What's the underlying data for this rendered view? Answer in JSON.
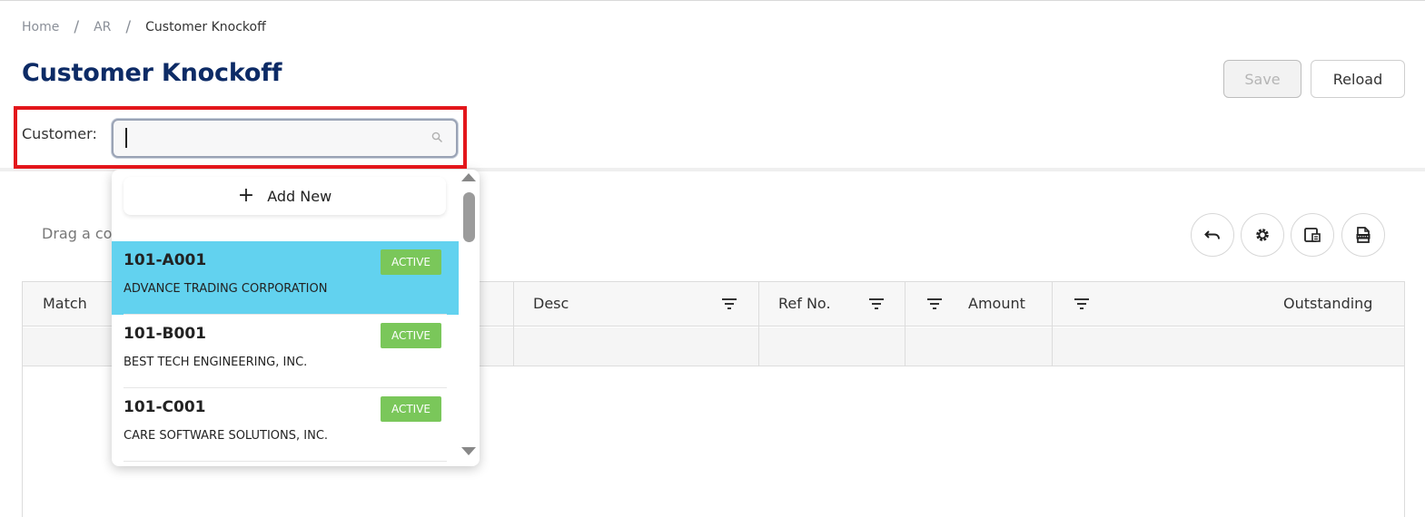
{
  "breadcrumb": {
    "items": [
      "Home",
      "AR",
      "Customer Knockoff"
    ],
    "separator": "/"
  },
  "page": {
    "title": "Customer Knockoff"
  },
  "toolbar": {
    "save_label": "Save",
    "reload_label": "Reload"
  },
  "customer": {
    "label": "Customer:",
    "value": ""
  },
  "grid": {
    "group_hint": "Drag a co",
    "columns": [
      "Match",
      "Desc",
      "Ref No.",
      "Amount",
      "Outstanding"
    ],
    "tools": [
      "undo-icon",
      "gear-icon",
      "column-chooser-icon",
      "export-icon"
    ]
  },
  "dropdown": {
    "add_new_label": "Add New",
    "options": [
      {
        "code": "101-A001",
        "name": "ADVANCE TRADING CORPORATION",
        "status": "ACTIVE",
        "selected": true
      },
      {
        "code": "101-B001",
        "name": "BEST TECH ENGINEERING, INC.",
        "status": "ACTIVE",
        "selected": false
      },
      {
        "code": "101-C001",
        "name": "CARE SOFTWARE SOLUTIONS, INC.",
        "status": "ACTIVE",
        "selected": false
      }
    ]
  },
  "colors": {
    "title": "#0d2b66",
    "selected_row": "#62d2ef",
    "status_active": "#7ac75a",
    "highlight": "#e3161b"
  }
}
